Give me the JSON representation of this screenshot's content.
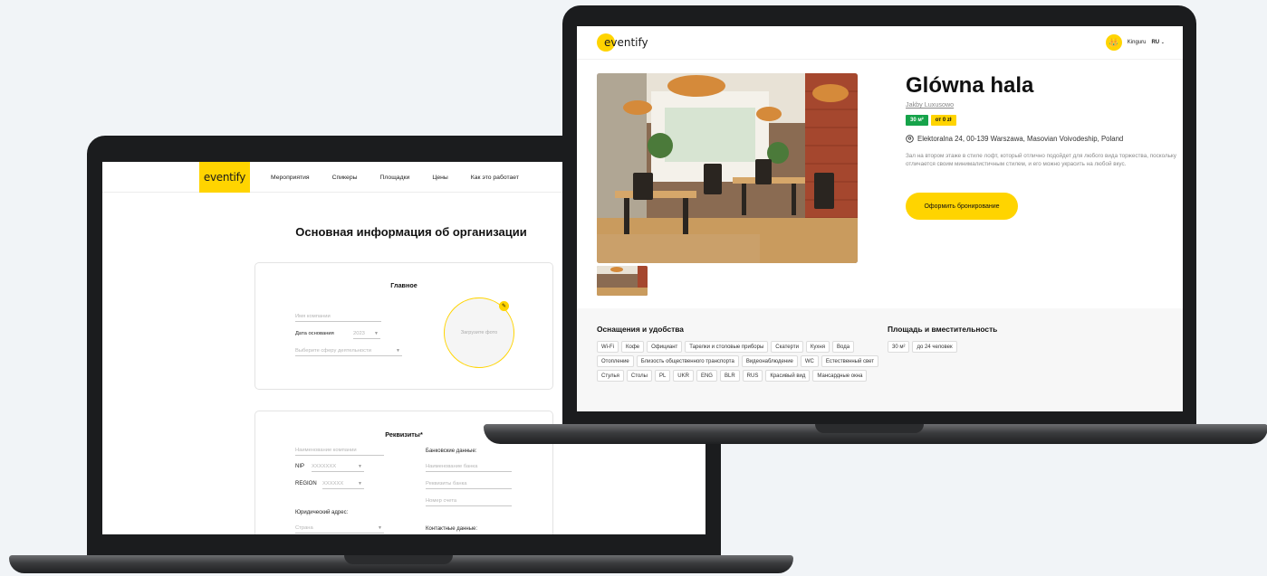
{
  "brand": {
    "logo_text": "eventify",
    "accent": "#ffd400",
    "tag_green": "#16a34a"
  },
  "back_app": {
    "nav": [
      "Мероприятия",
      "Спикеры",
      "Площадки",
      "Цены",
      "Как это работает"
    ],
    "page_title": "Основная информация об организации",
    "main_card": {
      "title": "Главное",
      "company_name_placeholder": "Имя компании",
      "founded_label": "Дата основания",
      "founded_year": "2023",
      "sphere_placeholder": "Выберите сферу деятельности",
      "upload_photo": "Загрузите фото"
    },
    "requisites_card": {
      "title": "Реквизиты*",
      "company_name_placeholder": "Наименование компании",
      "nip_label": "NIP",
      "nip_placeholder": "XXXXXXX",
      "region_label": "REGION",
      "region_placeholder": "XXXXXX",
      "legal_address_label": "Юридический адрес:",
      "country_placeholder": "Страна",
      "bank_label": "Банковские данные:",
      "bank_name_placeholder": "Наименование банка",
      "bank_details_placeholder": "Реквизиты банка",
      "account_placeholder": "Номер счета",
      "contact_label": "Контактные данные:"
    }
  },
  "front_app": {
    "user_name": "Kinguru",
    "language": "RU",
    "venue": {
      "title": "Glówna hala",
      "organizer": "Jakby Luxusowo",
      "area_tag": "30 м²",
      "price_tag": "от 0 zł",
      "address": "Elektoralna 24, 00-139 Warszawa, Masovian Voivodeship, Poland",
      "description": "Зал на втором этаже в стиле лофт, который отлично подойдет для любого вида торжества, поскольку отличается своим минималистичным стилем, и его можно украсить на любой вкус.",
      "book_button": "Оформить бронирование"
    },
    "amenities": {
      "title": "Оснащения и удобства",
      "items": [
        "Wi-Fi",
        "Кофе",
        "Официант",
        "Тарелки и столовые приборы",
        "Скатерти",
        "Кухня",
        "Вода",
        "Отопление",
        "Близость общественного транспорта",
        "Видеонаблюдение",
        "WC",
        "Естественный свет",
        "Стулья",
        "Столы",
        "PL",
        "UKR",
        "ENG",
        "BLR",
        "RUS",
        "Красивый вид",
        "Мансардные окна"
      ]
    },
    "capacity": {
      "title": "Площадь и вместительность",
      "items": [
        "30 м²",
        "до 24 человек"
      ]
    }
  }
}
